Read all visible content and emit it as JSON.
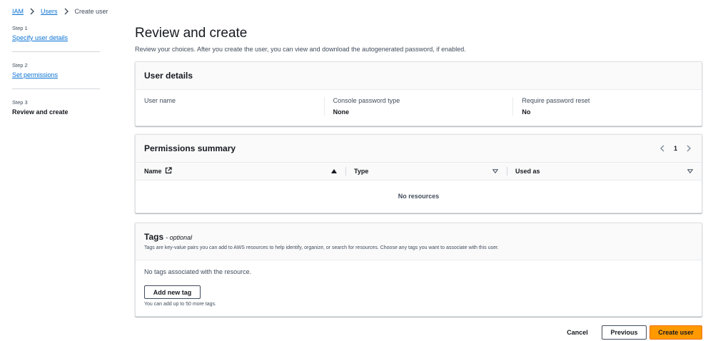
{
  "breadcrumb": {
    "items": [
      "IAM",
      "Users"
    ],
    "current": "Create user"
  },
  "steps": [
    {
      "num": "Step 1",
      "title": "Specify user details"
    },
    {
      "num": "Step 2",
      "title": "Set permissions"
    },
    {
      "num": "Step 3",
      "title": "Review and create"
    }
  ],
  "page": {
    "title": "Review and create",
    "description": "Review your choices. After you create the user, you can view and download the autogenerated password, if enabled."
  },
  "user_details": {
    "title": "User details",
    "fields": [
      {
        "label": "User name",
        "value": ""
      },
      {
        "label": "Console password type",
        "value": "None"
      },
      {
        "label": "Require password reset",
        "value": "No"
      }
    ]
  },
  "permissions": {
    "title": "Permissions summary",
    "page": "1",
    "columns": [
      "Name",
      "Type",
      "Used as"
    ],
    "empty": "No resources"
  },
  "tags": {
    "title": "Tags",
    "optional": "- optional",
    "description": "Tags are key-value pairs you can add to AWS resources to help identify, organize, or search for resources. Choose any tags you want to associate with this user.",
    "empty": "No tags associated with the resource.",
    "add_label": "Add new tag",
    "hint": "You can add up to 50 more tags."
  },
  "actions": {
    "cancel": "Cancel",
    "previous": "Previous",
    "create": "Create user"
  },
  "colors": {
    "link": "#0972d3",
    "primary": "#ff9900",
    "text": "#16191f"
  }
}
